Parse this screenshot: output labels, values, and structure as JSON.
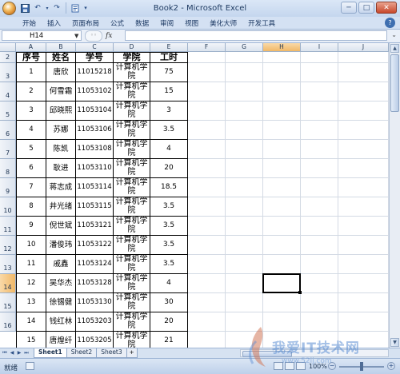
{
  "window": {
    "title": "Book2 - Microsoft Excel"
  },
  "ribbon": {
    "tabs": [
      "开始",
      "插入",
      "页面布局",
      "公式",
      "数据",
      "审阅",
      "视图",
      "美化大师",
      "开发工具"
    ]
  },
  "formula_bar": {
    "name_box": "H14",
    "fx_label": "fx",
    "value": ""
  },
  "columns": [
    "A",
    "B",
    "C",
    "D",
    "E",
    "F",
    "G",
    "H",
    "I",
    "J"
  ],
  "selected_column": "H",
  "row_numbers": [
    "2",
    "3",
    "4",
    "5",
    "6",
    "7",
    "8",
    "9",
    "10",
    "11",
    "12",
    "13",
    "14",
    "15",
    "16"
  ],
  "selected_row": "14",
  "table": {
    "headers": [
      "序号",
      "姓名",
      "学号",
      "学院",
      "工时"
    ],
    "rows": [
      [
        "1",
        "唐欣",
        "11015218",
        "计算机学院",
        "75"
      ],
      [
        "2",
        "何雪霜",
        "11053102",
        "计算机学院",
        "15"
      ],
      [
        "3",
        "邱晓熙",
        "11053104",
        "计算机学院",
        "3"
      ],
      [
        "4",
        "苏娜",
        "11053106",
        "计算机学院",
        "3.5"
      ],
      [
        "5",
        "陈凯",
        "11053108",
        "计算机学院",
        "4"
      ],
      [
        "6",
        "耿进",
        "11053110",
        "计算机学院",
        "20"
      ],
      [
        "7",
        "蒋志成",
        "11053114",
        "计算机学院",
        "18.5"
      ],
      [
        "8",
        "井光绪",
        "11053115",
        "计算机学院",
        "3.5"
      ],
      [
        "9",
        "倪世斌",
        "11053121",
        "计算机学院",
        "3.5"
      ],
      [
        "10",
        "潘俊玮",
        "11053122",
        "计算机学院",
        "3.5"
      ],
      [
        "11",
        "戚鑫",
        "11053124",
        "计算机学院",
        "3.5"
      ],
      [
        "12",
        "吴华杰",
        "11053128",
        "计算机学院",
        "4"
      ],
      [
        "13",
        "徐锡健",
        "11053130",
        "计算机学院",
        "30"
      ],
      [
        "14",
        "钱红林",
        "11053203",
        "计算机学院",
        "20"
      ],
      [
        "15",
        "唐煌纤",
        "11053205",
        "计算机学院",
        "21"
      ]
    ]
  },
  "sheet_tabs": [
    "Sheet1",
    "Sheet2",
    "Sheet3"
  ],
  "active_sheet": "Sheet1",
  "status": {
    "ready": "就绪",
    "zoom": "100%"
  },
  "watermark": {
    "text": "我爱IT技术网",
    "sub": "www.52ij.com"
  }
}
